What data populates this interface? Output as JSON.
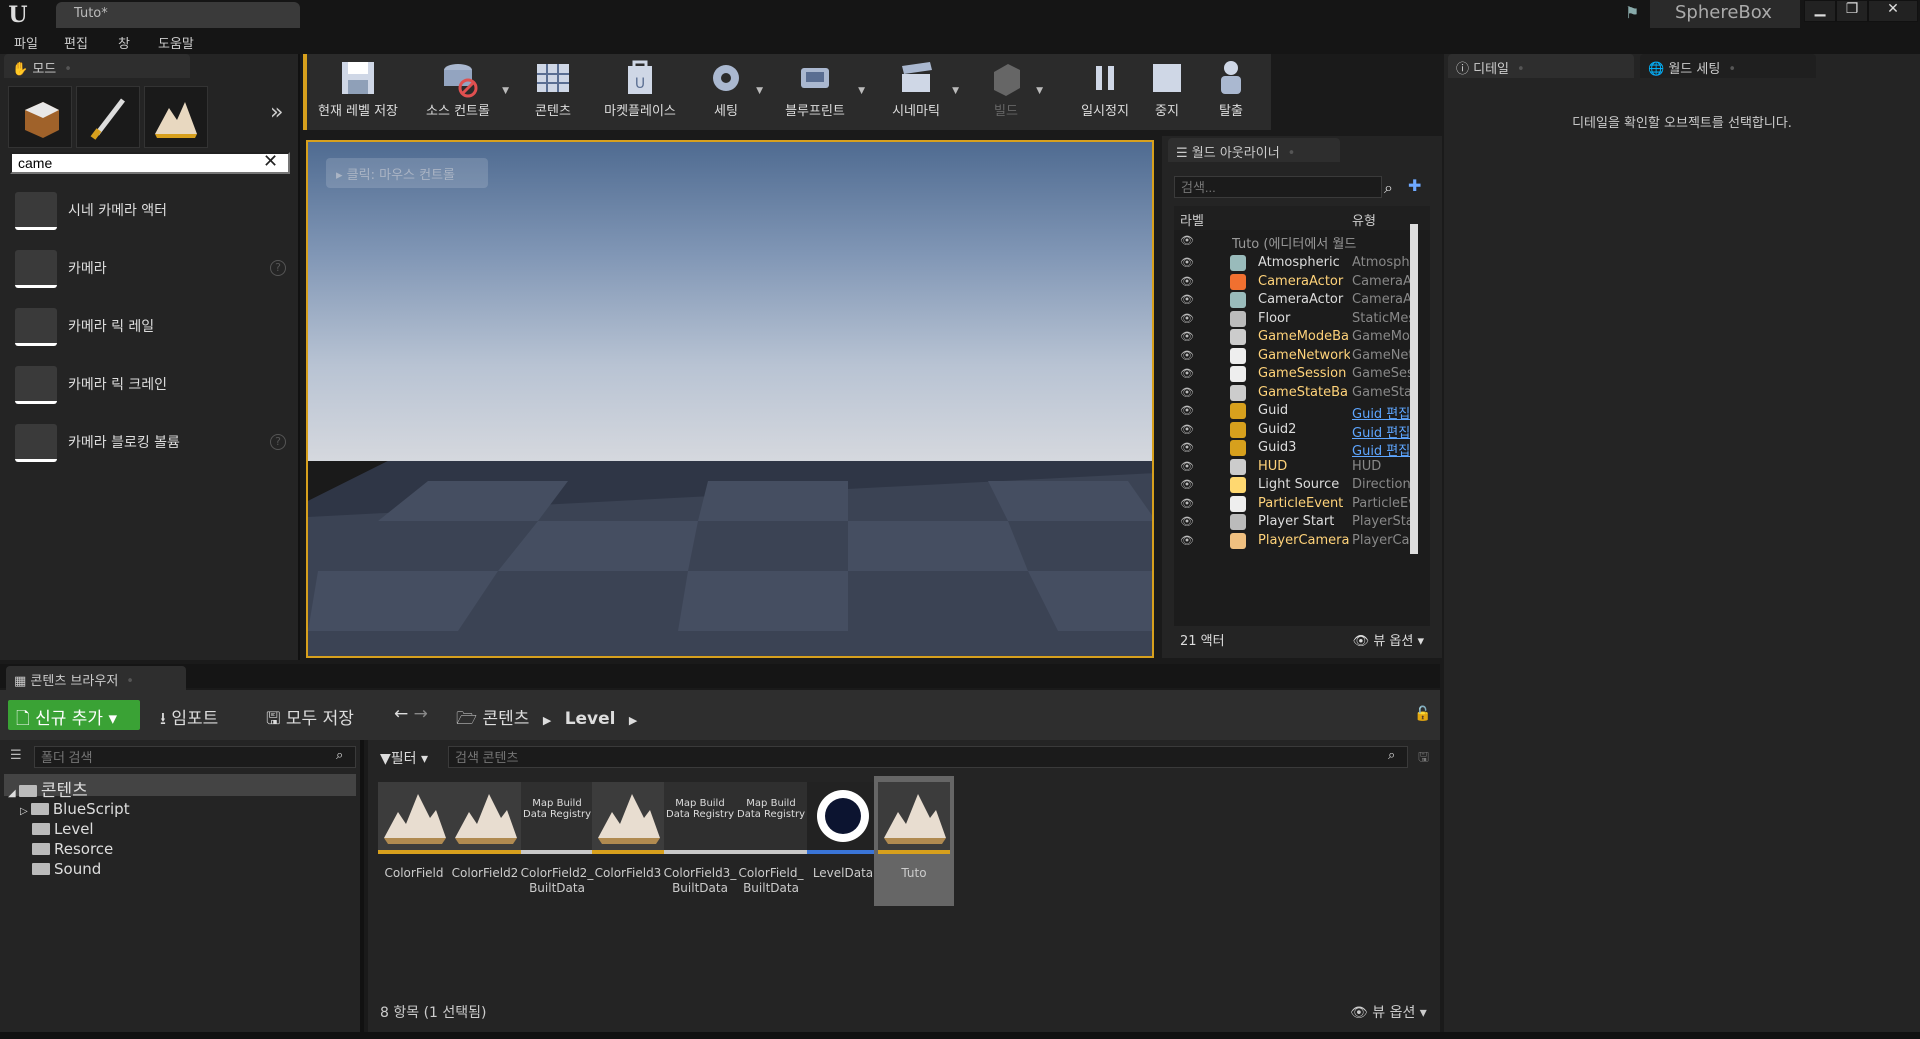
{
  "titlebar": {
    "tab": "Tuto*",
    "project": "SphereBox",
    "min": "▁",
    "max": "❐",
    "close": "✕"
  },
  "menu": [
    "파일",
    "편집",
    "창",
    "도움말"
  ],
  "modes": {
    "tab": "모드",
    "search_value": "came",
    "clear": "✕",
    "more": "»",
    "items": [
      {
        "label": "시네 카메라 액터",
        "help": false
      },
      {
        "label": "카메라",
        "help": true
      },
      {
        "label": "카메라 릭 레일",
        "help": false
      },
      {
        "label": "카메라 릭 크레인",
        "help": false
      },
      {
        "label": "카메라 블로킹 볼륨",
        "help": true
      }
    ]
  },
  "toolbar": [
    {
      "label": "현재 레벨 저장",
      "icon": "save-icon",
      "dropdown": false
    },
    {
      "label": "소스 컨트롤",
      "icon": "source-control-icon",
      "dropdown": true
    },
    {
      "label": "콘텐츠",
      "icon": "content-icon",
      "dropdown": false
    },
    {
      "label": "마켓플레이스",
      "icon": "marketplace-icon",
      "dropdown": false
    },
    {
      "label": "세팅",
      "icon": "settings-icon",
      "dropdown": true
    },
    {
      "label": "블루프린트",
      "icon": "blueprint-icon",
      "dropdown": true
    },
    {
      "label": "시네마틱",
      "icon": "cinematic-icon",
      "dropdown": true
    },
    {
      "label": "빌드",
      "icon": "build-icon",
      "dropdown": true
    },
    {
      "label": "일시정지",
      "icon": "pause-icon",
      "dropdown": false
    },
    {
      "label": "중지",
      "icon": "stop-icon",
      "dropdown": false
    },
    {
      "label": "탈출",
      "icon": "eject-icon",
      "dropdown": false
    }
  ],
  "viewport": {
    "hint": "클릭: 마우스 컨트롤"
  },
  "outliner": {
    "tab": "월드 아웃라이너",
    "search_placeholder": "검색...",
    "col_label": "라벨",
    "col_type": "유형",
    "root": "Tuto (에디터에서 월드",
    "rows": [
      {
        "label": "Atmospheric",
        "type": "Atmosph",
        "yellow": false,
        "link": false
      },
      {
        "label": "CameraActor",
        "type": "CameraA",
        "yellow": true,
        "link": false
      },
      {
        "label": "CameraActor",
        "type": "CameraA",
        "yellow": false,
        "link": false
      },
      {
        "label": "Floor",
        "type": "StaticMes",
        "yellow": false,
        "link": false
      },
      {
        "label": "GameModeBa",
        "type": "GameMo",
        "yellow": true,
        "link": false
      },
      {
        "label": "GameNetwork",
        "type": "GameNet",
        "yellow": true,
        "link": false
      },
      {
        "label": "GameSession",
        "type": "GameSes",
        "yellow": true,
        "link": false
      },
      {
        "label": "GameStateBa",
        "type": "GameSta",
        "yellow": true,
        "link": false
      },
      {
        "label": "Guid",
        "type": "Guid 편집",
        "yellow": false,
        "link": true
      },
      {
        "label": "Guid2",
        "type": "Guid 편집",
        "yellow": false,
        "link": true
      },
      {
        "label": "Guid3",
        "type": "Guid 편집",
        "yellow": false,
        "link": true
      },
      {
        "label": "HUD",
        "type": "HUD",
        "yellow": true,
        "link": false
      },
      {
        "label": "Light Source",
        "type": "Directiona",
        "yellow": false,
        "link": false
      },
      {
        "label": "ParticleEvent",
        "type": "ParticleEv",
        "yellow": true,
        "link": false
      },
      {
        "label": "Player Start",
        "type": "PlayerSta",
        "yellow": false,
        "link": false
      },
      {
        "label": "PlayerCamera",
        "type": "PlayerCa",
        "yellow": true,
        "link": false
      }
    ],
    "count": "21 액터",
    "view_options": "뷰 옵션"
  },
  "details": {
    "tab_details": "디테일",
    "tab_world": "월드 세팅",
    "message": "디테일을 확인할 오브젝트를 선택합니다."
  },
  "content_browser": {
    "tab": "콘텐츠 브라우저",
    "add_new": "신규 추가",
    "import": "임포트",
    "save_all": "모두 저장",
    "path": [
      "콘텐츠",
      "Level"
    ],
    "folder_search": "폴더 검색",
    "filter": "필터",
    "asset_search": "검색 콘텐츠",
    "tree": [
      "콘텐츠",
      "BlueScript",
      "Level",
      "Resorce",
      "Sound"
    ],
    "assets": [
      {
        "name": "ColorField",
        "kind": "map"
      },
      {
        "name": "ColorField2",
        "kind": "map"
      },
      {
        "name": "ColorField2_ BuiltData",
        "kind": "registry",
        "thumb": "Map Build Data Registry"
      },
      {
        "name": "ColorField3",
        "kind": "map"
      },
      {
        "name": "ColorField3_ BuiltData",
        "kind": "registry",
        "thumb": "Map Build Data Registry"
      },
      {
        "name": "ColorField_ BuiltData",
        "kind": "registry",
        "thumb": "Map Build Data Registry"
      },
      {
        "name": "LevelData",
        "kind": "level"
      },
      {
        "name": "Tuto",
        "kind": "map",
        "selected": true
      }
    ],
    "count": "8 항목 (1 선택됨)",
    "view_options": "뷰 옵션"
  }
}
